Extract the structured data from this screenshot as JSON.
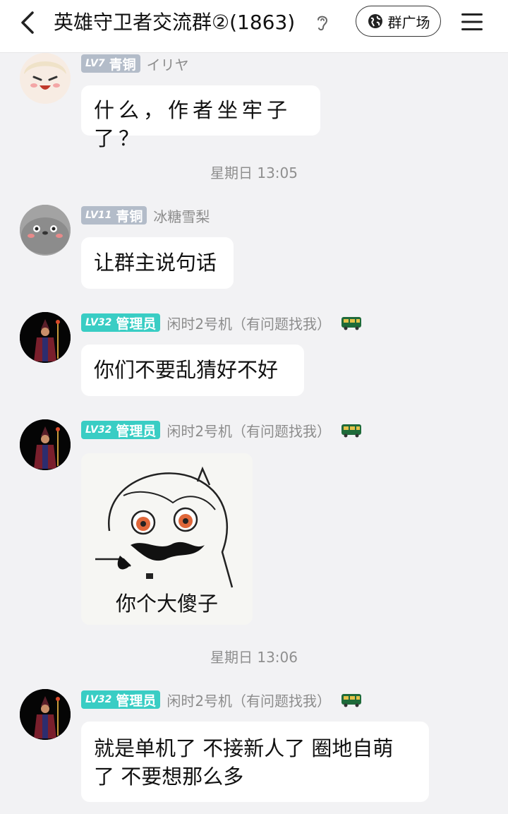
{
  "header": {
    "back_icon": "chevron-left-icon",
    "title": "英雄守卫者交流群②(1863)",
    "ear_icon": "ear-icon",
    "plaza_label": "群广场",
    "plaza_icon": "globe-icon",
    "menu_icon": "hamburger-menu-icon"
  },
  "colors": {
    "admin_badge": "#39cdc4",
    "bronze_badge": "#b3bcc9",
    "background": "#f2f2f4"
  },
  "messages": [
    {
      "level": "LV7",
      "rank": "青铜",
      "nick": "イリヤ",
      "text": "什么，作者坐牢子了？"
    },
    {
      "level": "LV11",
      "rank": "青铜",
      "nick": "冰糖雪梨",
      "text": "让群主说句话"
    },
    {
      "level": "LV32",
      "rank": "管理员",
      "nick": "闲时2号机（有问题找我）",
      "text": "你们不要乱猜好不好"
    },
    {
      "level": "LV32",
      "rank": "管理员",
      "nick": "闲时2号机（有问题找我）",
      "sticker_caption": "你个大傻子"
    },
    {
      "level": "LV32",
      "rank": "管理员",
      "nick": "闲时2号机（有问题找我）",
      "text_line1": "就是单机了 不接新人了 圈地自萌",
      "text_line2": "了 不要想那么多"
    }
  ],
  "timestamps": [
    "星期日 13:05",
    "星期日 13:06"
  ]
}
